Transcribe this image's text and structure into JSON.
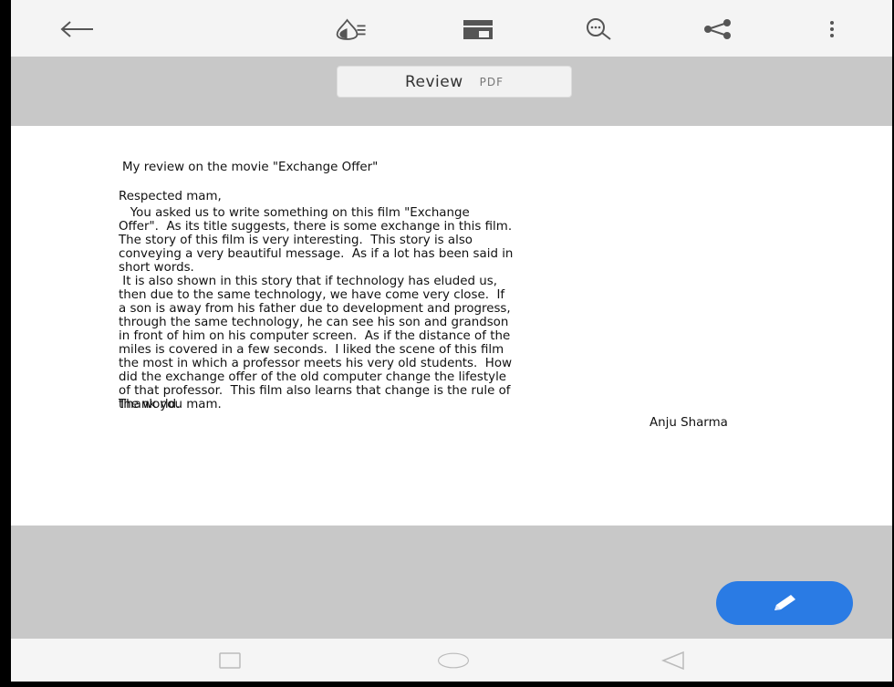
{
  "toolbar": {
    "icons": [
      "back-arrow-icon",
      "ink-brightness-icon",
      "page-layout-icon",
      "search-icon",
      "share-icon",
      "more-vertical-icon"
    ]
  },
  "document_tab": {
    "name": "Review",
    "extension": "PDF"
  },
  "document": {
    "title": "My review on the movie \"Exchange Offer\"",
    "salutation": "Respected mam,",
    "paragraph1": "   You asked us to write something on this film \"Exchange\nOffer\".  As its title suggests, there is some exchange in this film.\nThe story of this film is very interesting.  This story is also\nconveying a very beautiful message.  As if a lot has been said in\nshort words.",
    "paragraph2": " It is also shown in this story that if technology has eluded us,\nthen due to the same technology, we have come very close.  If\na son is away from his father due to development and progress,\nthrough the same technology, he can see his son and grandson\nin front of him on his computer screen.  As if the distance of the\nmiles is covered in a few seconds.  I liked the scene of this film\nthe most in which a professor meets his very old students.  How\ndid the exchange offer of the old computer change the lifestyle\nof that professor.  This film also learns that change is the rule of\nthe world.",
    "closing": "Thank you mam.",
    "signature": "Anju Sharma"
  },
  "fab": {
    "icon": "pencil-icon",
    "color": "#2a7be4"
  },
  "navbar": {
    "icons": [
      "recents-square-icon",
      "home-circle-icon",
      "back-triangle-icon"
    ]
  }
}
